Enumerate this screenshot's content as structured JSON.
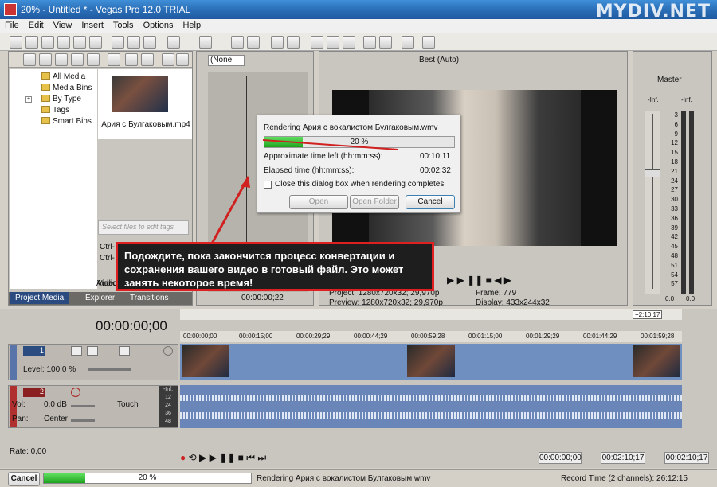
{
  "window": {
    "title": "20% - Untitled * - Vegas Pro 12.0 TRIAL",
    "watermark": "MYDIV.NET"
  },
  "menu": [
    "File",
    "Edit",
    "View",
    "Insert",
    "Tools",
    "Options",
    "Help"
  ],
  "explorer": {
    "tree": [
      "All Media",
      "Media Bins",
      "By Type",
      "Tags",
      "Smart Bins"
    ],
    "media_file": "Ария с Булгаковым.mp4",
    "tags_placeholder": "Select files to edit tags",
    "ctrl_lines": [
      "Ctrl-",
      "Ctrl-"
    ],
    "partial_labels": [
      "Video",
      "Audio"
    ],
    "tabs": [
      "Project Media",
      "Explorer",
      "Transitions"
    ]
  },
  "trimmer": {
    "dropdown": "(None",
    "timecode": "00:00:00;22"
  },
  "preview": {
    "quality": "Best (Auto)",
    "project_label": "Project:",
    "project_value": "1280x720x32; 29,970p",
    "preview_label": "Preview:",
    "preview_value": "1280x720x32; 29,970p",
    "frame_label": "Frame:",
    "frame_value": "779",
    "display_label": "Display:",
    "display_value": "433x244x32"
  },
  "mixer": {
    "title": "Master",
    "inf_left": "-Inf.",
    "inf_right": "-Inf.",
    "scale": [
      "3",
      "6",
      "9",
      "12",
      "15",
      "18",
      "21",
      "24",
      "27",
      "30",
      "33",
      "36",
      "39",
      "42",
      "45",
      "48",
      "51",
      "54",
      "57"
    ],
    "bottom_left": "0.0",
    "bottom_right": "0.0"
  },
  "render_dialog": {
    "title": "Rendering Ария с вокалистом Булгаковым.wmv",
    "progress_text": "20 %",
    "progress": 0.2,
    "time_left_label": "Approximate time left (hh:mm:ss):",
    "time_left_value": "00:10:11",
    "elapsed_label": "Elapsed time (hh:mm:ss):",
    "elapsed_value": "00:02:32",
    "checkbox_label": "Close this dialog box when rendering completes",
    "open_button": "Open",
    "open_folder_button": "Open Folder",
    "cancel_button": "Cancel"
  },
  "callout": {
    "text": "Подождите, пока закончится процесс конвертации и сохранения вашего видео в готовый файл. Это может занять некоторое время!"
  },
  "timeline": {
    "timecode": "00:00:00;00",
    "length_marker": "+2:10:17",
    "ruler": [
      "00:00:00;00",
      "00:00:15;00",
      "00:00:29;29",
      "00:00:44;29",
      "00:00:59;28",
      "00:01:15;00",
      "00:01:29;29",
      "00:01:44;29",
      "00:01:59;28"
    ],
    "video_track": {
      "number": "1",
      "level": "Level: 100,0 %"
    },
    "audio_track": {
      "number": "2",
      "vol_label": "Vol:",
      "vol_value": "0,0 dB",
      "pan_label": "Pan:",
      "pan_value": "Center",
      "touch": "Touch",
      "meter": [
        "-Inf.",
        "12",
        "24",
        "36",
        "48"
      ]
    },
    "rate": "Rate: 0,00",
    "transport_time_1": "00:00:00;00",
    "transport_time_2": "00:02:10;17",
    "transport_time_3": "00:02:10;17"
  },
  "status": {
    "cancel": "Cancel",
    "progress_text": "20 %",
    "progress": 0.2,
    "message": "Rendering Ария с вокалистом Булгаковым.wmv",
    "record_time": "Record Time (2 channels): 26:12:15"
  },
  "colors": {
    "accent_green": "#2db52d",
    "callout_border": "#e02020",
    "clip_blue": "#6f8fc0"
  }
}
